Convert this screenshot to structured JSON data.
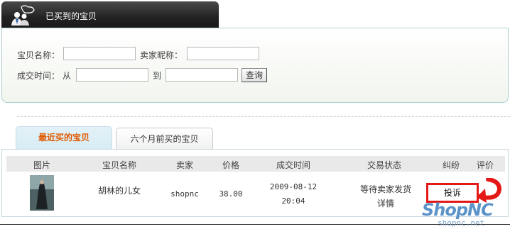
{
  "header": {
    "title": "已买到的宝贝",
    "icon": "users-icon"
  },
  "search": {
    "item_name_label": "宝贝名称：",
    "seller_label": "卖家昵称：",
    "time_label": "成交时间：",
    "from_label": "从",
    "to_label": "到",
    "query_button": "查询",
    "item_name_value": "",
    "seller_value": "",
    "from_value": "",
    "to_value": ""
  },
  "tabs": [
    {
      "label": "最近买的宝贝",
      "active": true
    },
    {
      "label": "六个月前买的宝贝",
      "active": false
    }
  ],
  "table": {
    "columns": [
      "图片",
      "宝贝名称",
      "卖家",
      "价格",
      "成交时间",
      "交易状态",
      "纠纷",
      "评价"
    ],
    "rows": [
      {
        "name": "胡林的儿女",
        "seller": "shopnc",
        "price": "38.00",
        "date": "2009-08-12",
        "time": "20:04",
        "status": "等待卖家发货",
        "detail": "详情",
        "dispute": "投诉"
      }
    ]
  },
  "watermark": {
    "logo": "ShopNC",
    "site": "shopnc.net"
  },
  "colors": {
    "accent": "#e05a00",
    "highlight": "#e51818",
    "logo": "#5b93c9"
  }
}
